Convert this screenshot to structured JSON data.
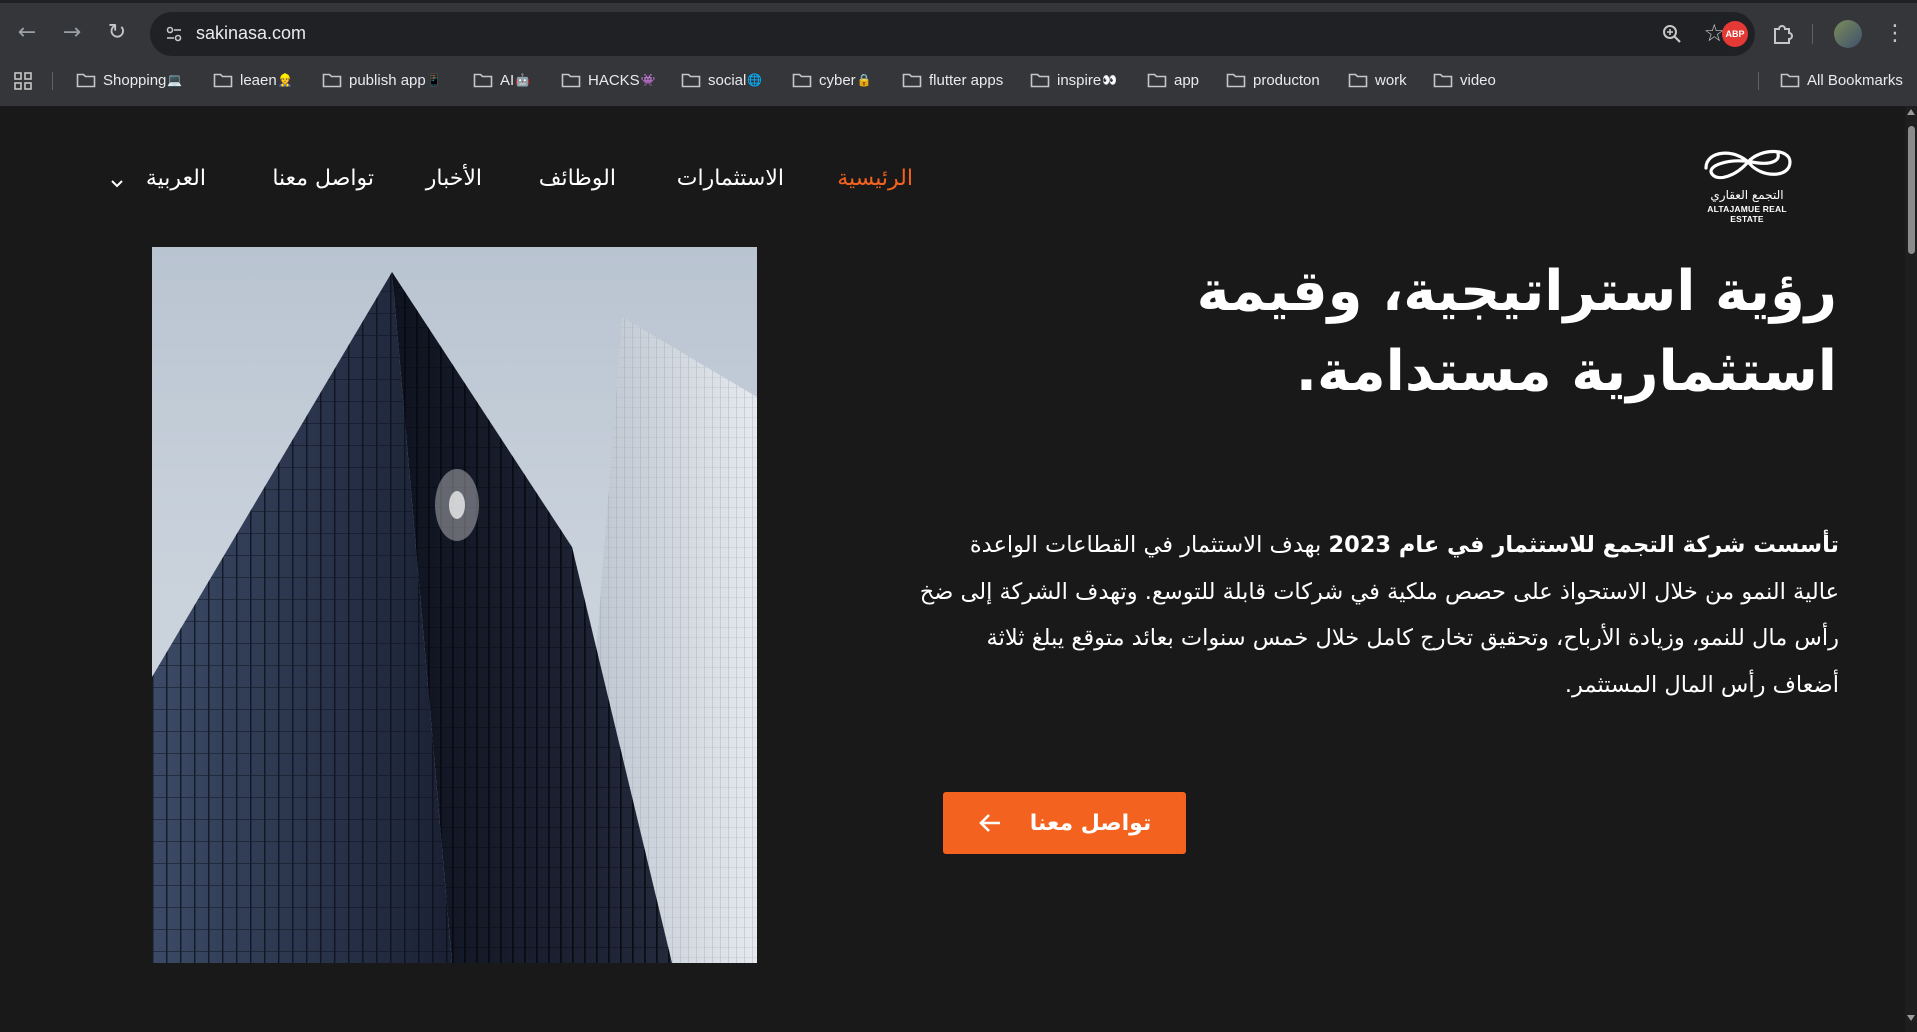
{
  "browser": {
    "url": "sakinasa.com",
    "nav": {
      "back": "←",
      "forward": "→",
      "reload": "↻"
    },
    "extensions": {
      "abp": "ABP"
    },
    "menu_glyph": "⋮",
    "star_glyph": "☆",
    "bookmarks": [
      {
        "label": "Shopping",
        "emoji": "💻"
      },
      {
        "label": "leaen",
        "emoji": "👷"
      },
      {
        "label": "publish app",
        "emoji": "📱"
      },
      {
        "label": "AI",
        "emoji": "🤖"
      },
      {
        "label": "HACKS",
        "emoji": "👾"
      },
      {
        "label": "social",
        "emoji": "🌐"
      },
      {
        "label": "cyber",
        "emoji": "🔒"
      },
      {
        "label": "flutter apps",
        "emoji": ""
      },
      {
        "label": "inspire",
        "emoji": "👀"
      },
      {
        "label": "app",
        "emoji": ""
      },
      {
        "label": "producton",
        "emoji": ""
      },
      {
        "label": "work",
        "emoji": ""
      },
      {
        "label": "video",
        "emoji": ""
      }
    ],
    "all_bookmarks": "All Bookmarks"
  },
  "site": {
    "logo": {
      "arabic": "التجمع العقاري",
      "english": "ALTAJAMUE REAL ESTATE"
    },
    "nav": {
      "home": "الرئيسية",
      "investments": "الاستثمارات",
      "jobs": "الوظائف",
      "news": "الأخبار",
      "contact": "تواصل معنا",
      "language": "العربية"
    },
    "hero": {
      "heading": "رؤية استراتيجية، وقيمة استثمارية مستدامة.",
      "paragraph_bold": "تأسست شركة التجمع للاستثمار في عام 2023",
      "paragraph_rest": " بهدف الاستثمار في القطاعات الواعدة عالية النمو من خلال الاستحواذ على حصص ملكية في شركات قابلة للتوسع. وتهدف الشركة إلى ضخ رأس مال للنمو، وزيادة الأرباح، وتحقيق تخارج كامل خلال خمس سنوات بعائد متوقع يبلغ ثلاثة أضعاف رأس المال المستثمر.",
      "cta": "تواصل معنا"
    },
    "accent_color": "#f4621f",
    "background_color": "#191919"
  }
}
